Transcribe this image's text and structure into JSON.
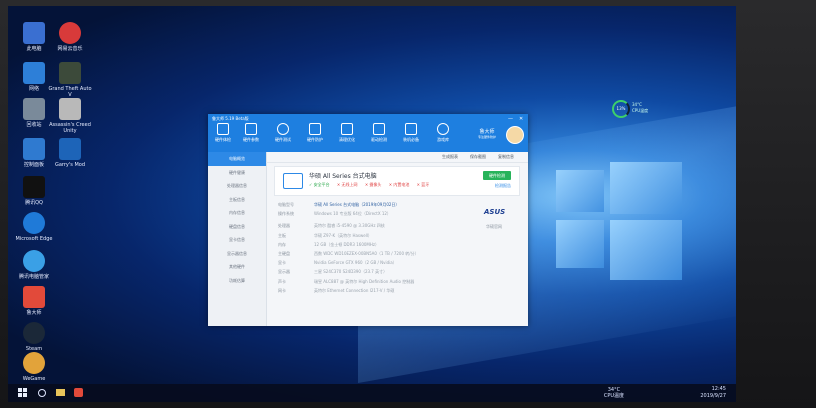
{
  "desktop": {
    "icons": [
      {
        "label": "此电脑",
        "color": "#3a6fd1"
      },
      {
        "label": "网易云音乐",
        "color": "#d83a3a"
      },
      {
        "label": "网络",
        "color": "#2d7fd8"
      },
      {
        "label": "Grand Theft Auto V",
        "color": "#3c4a3a"
      },
      {
        "label": "回收站",
        "color": "#7a8a9a"
      },
      {
        "label": "Assassin's Creed Unity",
        "color": "#b9b9b9"
      },
      {
        "label": "控制面板",
        "color": "#2f7ad0"
      },
      {
        "label": "Garry's Mod",
        "color": "#1d64b8"
      },
      {
        "label": "腾讯QQ",
        "color": "#111111"
      },
      {
        "label": "Microsoft Edge",
        "color": "#1f7ad8"
      },
      {
        "label": "腾讯电脑管家",
        "color": "#3aa0e6"
      },
      {
        "label": "鲁大师",
        "color": "#e24a3a"
      },
      {
        "label": "Steam",
        "color": "#1b2838"
      },
      {
        "label": "WeGame",
        "color": "#e2a33a"
      }
    ]
  },
  "widget": {
    "percent": "13%",
    "line1": "34°C",
    "line2": "CPU温度"
  },
  "app": {
    "title": "鲁大师 5.19 Beta版",
    "nav": [
      "硬件体检",
      "硬件参数",
      "硬件测试",
      "硬件防护",
      "清理优化",
      "驱动检测",
      "装机必备",
      "游戏库"
    ],
    "brand": "鲁大师",
    "brand_sub": "专注硬件防护",
    "winctl": [
      "—",
      "✕"
    ],
    "sidebar": [
      "电脑概览",
      "硬件健康",
      "处理器信息",
      "主板信息",
      "内存信息",
      "硬盘信息",
      "显卡信息",
      "显示器信息",
      "其他硬件",
      "功耗估算"
    ],
    "toolbar": [
      "生成报表",
      "保存截图",
      "复制信息"
    ],
    "card": {
      "model": "华硕 All Series 台式电脑",
      "tags": [
        {
          "text": "✓ 安全平台",
          "status": "ok"
        },
        {
          "text": "✕ 无线上网",
          "status": "bad"
        },
        {
          "text": "✕ 摄像头",
          "status": "bad"
        },
        {
          "text": "✕ 内置电池",
          "status": "bad"
        },
        {
          "text": "✕ 蓝牙",
          "status": "bad"
        }
      ],
      "detect_button": "硬件检测",
      "report_link": "检测报告"
    },
    "rows": [
      {
        "k": "电脑型号",
        "v": "华硕 All Series 台式电脑（2019年09月02日）"
      },
      {
        "k": "操作系统",
        "v": "Windows 10 专业版 64位（DirectX 12）"
      },
      {
        "k": "处理器",
        "v": "英特尔 酷睿 i5-4590 @ 3.30GHz 四核"
      },
      {
        "k": "主板",
        "v": "华硕 Z97-K（英特尔 Haswell）"
      },
      {
        "k": "内存",
        "v": "12 GB（金士顿 DDR3 1600MHz）"
      },
      {
        "k": "主硬盘",
        "v": "西数 WDC WD10EZEX-00BN5A0（1 TB / 7200 转/分）"
      },
      {
        "k": "显卡",
        "v": "Nvidia GeForce GTX 960（2 GB / Nvidia）"
      },
      {
        "k": "显示器",
        "v": "三星 S24C370 S24D390（23.7 英寸）"
      },
      {
        "k": "声卡",
        "v": "瑞昱 ALC887 @ 英特尔 High Definition Audio 控制器"
      },
      {
        "k": "网卡",
        "v": "英特尔 Ethernet Connection I217-V / 华硕"
      }
    ],
    "manufacturer": "ASUS",
    "manufacturer_link": "华硕官网"
  },
  "taskbar": {
    "temp": "34°C",
    "temp_label": "CPU温度",
    "time": "12:45",
    "date": "2019/9/27"
  }
}
